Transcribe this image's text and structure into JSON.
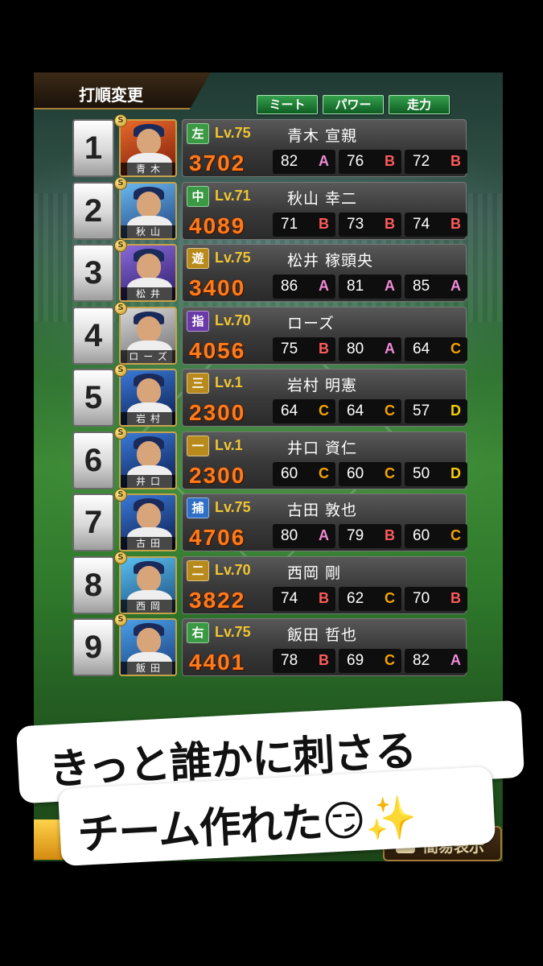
{
  "header": {
    "title": "打順変更",
    "sort_buttons": [
      "ミート",
      "パワー",
      "走力"
    ]
  },
  "colors": {
    "grade_A": "#f08bd8",
    "grade_B": "#ff5a5a",
    "grade_C": "#f5a300",
    "grade_D": "#f5d000",
    "pos_outfield": "#3a9a44",
    "pos_infield": "#b88a1c",
    "pos_shortstop": "#b88a1c",
    "pos_dh": "#6a3aa8",
    "pos_catcher": "#2f6fc8",
    "power_text": "#ff7b1a",
    "level_text": "#f0c531"
  },
  "lineup": [
    {
      "order": "1",
      "pos": "左",
      "level": "Lv.75",
      "name": "青木 宣親",
      "short": "青木",
      "power": "3702",
      "stats": [
        {
          "v": "82",
          "g": "A"
        },
        {
          "v": "76",
          "g": "B"
        },
        {
          "v": "72",
          "g": "B"
        }
      ]
    },
    {
      "order": "2",
      "pos": "中",
      "level": "Lv.71",
      "name": "秋山 幸二",
      "short": "秋山",
      "power": "4089",
      "stats": [
        {
          "v": "71",
          "g": "B"
        },
        {
          "v": "73",
          "g": "B"
        },
        {
          "v": "74",
          "g": "B"
        }
      ]
    },
    {
      "order": "3",
      "pos": "遊",
      "level": "Lv.75",
      "name": "松井 稼頭央",
      "short": "松井",
      "power": "3400",
      "stats": [
        {
          "v": "86",
          "g": "A"
        },
        {
          "v": "81",
          "g": "A"
        },
        {
          "v": "85",
          "g": "A"
        }
      ]
    },
    {
      "order": "4",
      "pos": "指",
      "level": "Lv.70",
      "name": "ローズ",
      "short": "ローズ",
      "power": "4056",
      "stats": [
        {
          "v": "75",
          "g": "B"
        },
        {
          "v": "80",
          "g": "A"
        },
        {
          "v": "64",
          "g": "C"
        }
      ]
    },
    {
      "order": "5",
      "pos": "三",
      "level": "Lv.1",
      "name": "岩村 明憲",
      "short": "岩村",
      "power": "2300",
      "stats": [
        {
          "v": "64",
          "g": "C"
        },
        {
          "v": "64",
          "g": "C"
        },
        {
          "v": "57",
          "g": "D"
        }
      ]
    },
    {
      "order": "6",
      "pos": "一",
      "level": "Lv.1",
      "name": "井口 資仁",
      "short": "井口",
      "power": "2300",
      "stats": [
        {
          "v": "60",
          "g": "C"
        },
        {
          "v": "60",
          "g": "C"
        },
        {
          "v": "50",
          "g": "D"
        }
      ]
    },
    {
      "order": "7",
      "pos": "捕",
      "level": "Lv.75",
      "name": "古田 敦也",
      "short": "古田",
      "power": "4706",
      "stats": [
        {
          "v": "80",
          "g": "A"
        },
        {
          "v": "79",
          "g": "B"
        },
        {
          "v": "60",
          "g": "C"
        }
      ]
    },
    {
      "order": "8",
      "pos": "二",
      "level": "Lv.70",
      "name": "西岡 剛",
      "short": "西岡",
      "power": "3822",
      "stats": [
        {
          "v": "74",
          "g": "B"
        },
        {
          "v": "62",
          "g": "C"
        },
        {
          "v": "70",
          "g": "B"
        }
      ]
    },
    {
      "order": "9",
      "pos": "右",
      "level": "Lv.75",
      "name": "飯田 哲也",
      "short": "飯田",
      "power": "4401",
      "stats": [
        {
          "v": "78",
          "g": "B"
        },
        {
          "v": "69",
          "g": "C"
        },
        {
          "v": "82",
          "g": "A"
        }
      ]
    }
  ],
  "footer": {
    "simple_view_label": "簡易表示"
  },
  "caption": {
    "line1": "きっと誰かに刺さる",
    "line2": "チーム作れた😏✨"
  }
}
